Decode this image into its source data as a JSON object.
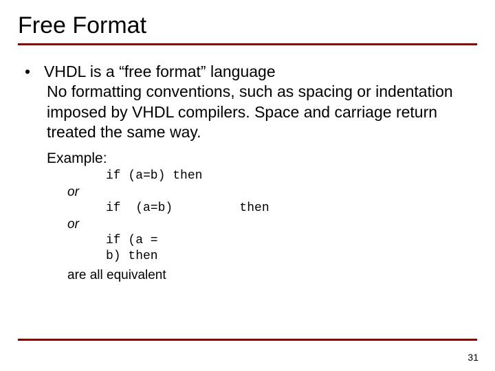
{
  "title": "Free Format",
  "bullet": "VHDL is a “free format” language",
  "desc": "No formatting conventions, such as spacing or indentation imposed by VHDL compilers. Space and carriage return treated the same way.",
  "example_label": "Example:",
  "code1": "if (a=b) then",
  "or1": "or",
  "code2": "if  (a=b)         then",
  "or2": "or",
  "code3a": "if (a =",
  "code3b": "b) then",
  "closing": "are all equivalent",
  "page_number": "31"
}
